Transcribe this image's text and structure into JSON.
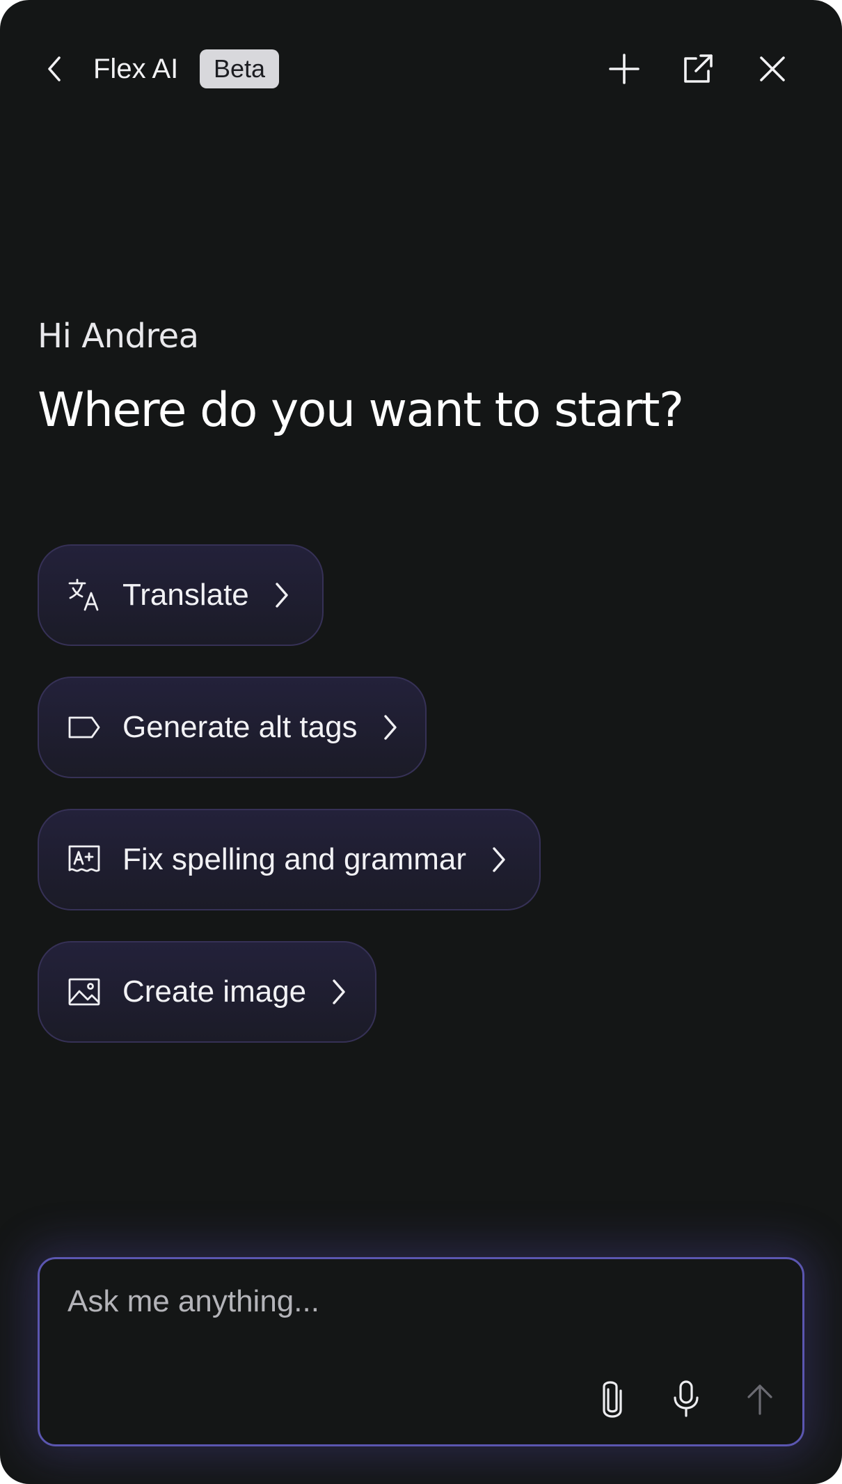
{
  "header": {
    "back_icon": "chevron-left-icon",
    "title": "Flex AI",
    "badge": "Beta",
    "actions": [
      {
        "name": "new-chat",
        "icon": "plus-icon"
      },
      {
        "name": "pop-out",
        "icon": "external-link-icon"
      },
      {
        "name": "close",
        "icon": "close-icon"
      }
    ]
  },
  "main": {
    "greeting": "Hi Andrea",
    "headline": "Where do you want to start?",
    "suggestions": [
      {
        "label": "Translate",
        "icon": "translate-icon"
      },
      {
        "label": "Generate alt tags",
        "icon": "tag-icon"
      },
      {
        "label": "Fix spelling and grammar",
        "icon": "spellcheck-icon"
      },
      {
        "label": "Create image",
        "icon": "image-icon"
      }
    ]
  },
  "composer": {
    "placeholder": "Ask me anything...",
    "value": "",
    "actions": [
      {
        "name": "attach",
        "icon": "paperclip-icon"
      },
      {
        "name": "voice",
        "icon": "microphone-icon"
      },
      {
        "name": "send",
        "icon": "arrow-up-icon",
        "enabled": false
      }
    ]
  },
  "colors": {
    "background": "#141616",
    "chip_border": "#363156",
    "composer_border": "#5b56b0",
    "badge_bg": "#d8d8dc"
  }
}
